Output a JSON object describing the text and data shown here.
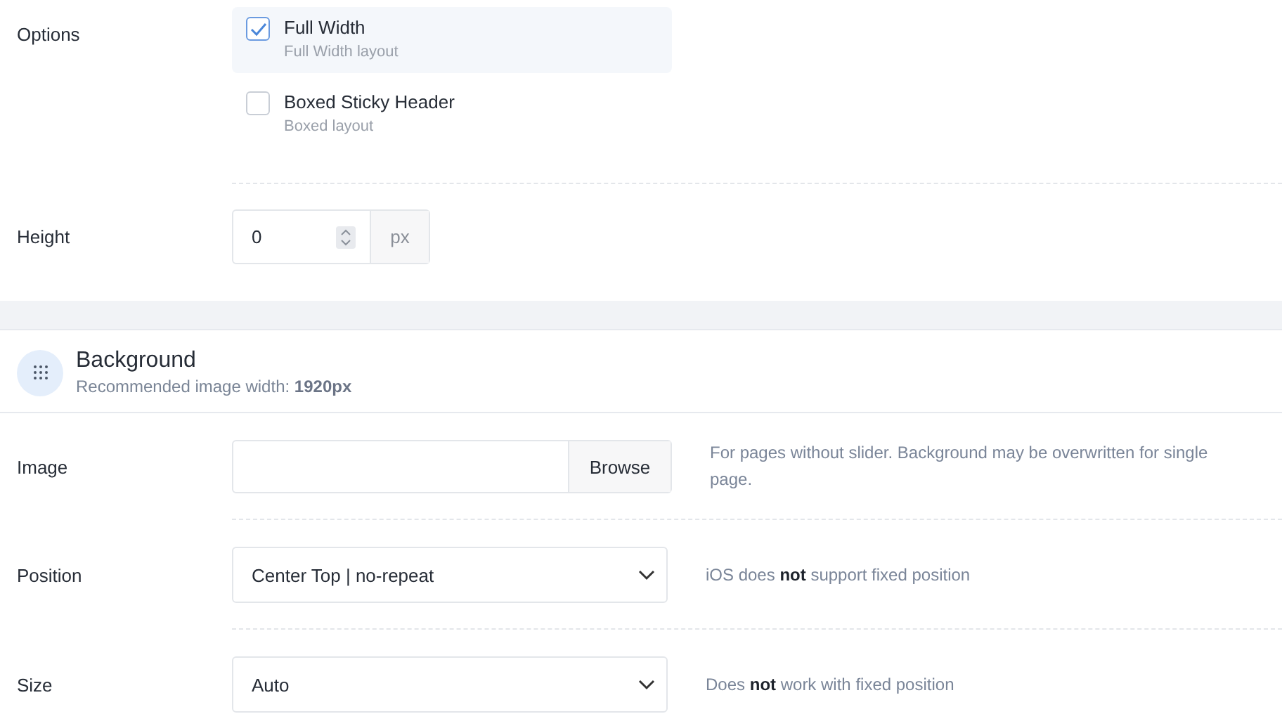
{
  "options": {
    "label": "Options",
    "items": [
      {
        "title": "Full Width",
        "subtitle": "Full Width layout",
        "checked": true
      },
      {
        "title": "Boxed Sticky Header",
        "subtitle": "Boxed layout",
        "checked": false
      }
    ]
  },
  "height": {
    "label": "Height",
    "value": "0",
    "unit": "px"
  },
  "background": {
    "title": "Background",
    "subtitle": "Recommended image width: **1920px**",
    "fields": [
      {
        "kind": "file",
        "label": "Image",
        "button": "Browse",
        "note": "For pages without slider. Background may be overwritten for single page."
      },
      {
        "kind": "select",
        "label": "Position",
        "value": "Center Top | no-repeat",
        "note": "iOS does **not** support fixed position"
      },
      {
        "kind": "select",
        "label": "Size",
        "value": "Auto",
        "note": "Does **not** work with fixed position"
      }
    ]
  }
}
